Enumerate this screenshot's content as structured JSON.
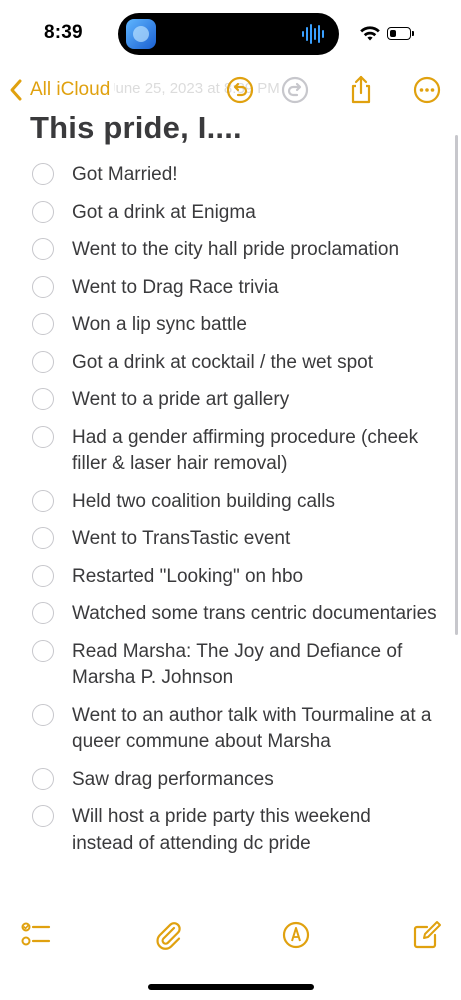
{
  "status_bar": {
    "time": "8:39"
  },
  "nav": {
    "back_label": "All iCloud",
    "date_header": "June 25, 2023 at 8:39 PM"
  },
  "note": {
    "title": "This pride, I....",
    "items": [
      {
        "text": "Got Married!",
        "checked": false
      },
      {
        "text": "Got a drink at Enigma",
        "checked": false
      },
      {
        "text": "Went to the city hall pride proclamation",
        "checked": false
      },
      {
        "text": "Went to Drag Race trivia",
        "checked": false
      },
      {
        "text": "Won a lip sync battle",
        "checked": false
      },
      {
        "text": "Got a drink at cocktail / the wet spot",
        "checked": false
      },
      {
        "text": "Went to a pride art gallery",
        "checked": false
      },
      {
        "text": "Had a gender affirming procedure (cheek filler & laser hair removal)",
        "checked": false
      },
      {
        "text": "Held two coalition building calls",
        "checked": false
      },
      {
        "text": "Went to TransTastic event",
        "checked": false
      },
      {
        "text": "Restarted \"Looking\" on hbo",
        "checked": false
      },
      {
        "text": "Watched some trans centric documentaries",
        "checked": false
      },
      {
        "text": "Read Marsha: The Joy and Defiance of Marsha P. Johnson",
        "checked": false
      },
      {
        "text": "Went to an author talk with Tourmaline at a queer commune about Marsha",
        "checked": false
      },
      {
        "text": "Saw drag performances",
        "checked": false
      },
      {
        "text": "Will host a pride party this weekend instead of attending dc pride",
        "checked": false
      }
    ]
  },
  "theme": {
    "accent": "#e0a10f",
    "text": "#3a3a3c",
    "checkbox_border": "#c7c7cc"
  },
  "icons": {
    "back": "chevron-left-icon",
    "undo": "undo-icon",
    "redo": "redo-icon",
    "share": "share-icon",
    "more": "ellipsis-circle-icon",
    "checklist": "checklist-icon",
    "attach": "paperclip-icon",
    "markup": "pen-tip-icon",
    "compose": "compose-icon"
  },
  "battery_level": 0.35
}
